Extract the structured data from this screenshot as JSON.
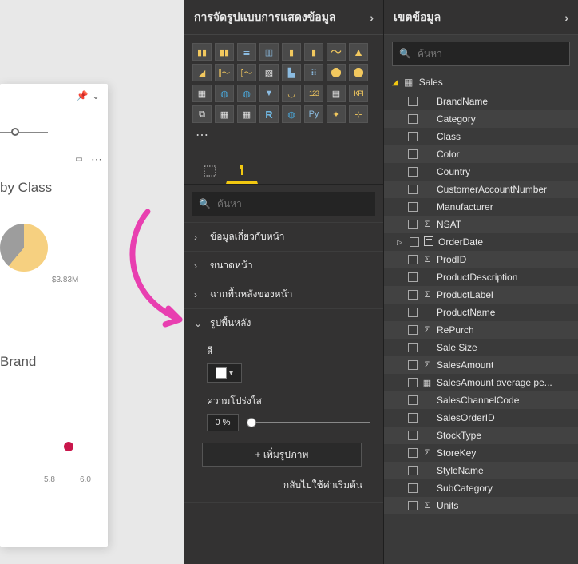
{
  "canvas": {
    "chart1_title": "by Class",
    "chart1_label": "$3.83M",
    "chart2_title": "Brand",
    "axis_tick1": "5.8",
    "axis_tick2": "6.0"
  },
  "viz": {
    "header": "การจัดรูปแบบการแสดงข้อมูล",
    "search_placeholder": "ค้นหา",
    "sections": {
      "page_info": "ข้อมูลเกี่ยวกับหน้า",
      "page_size": "ขนาดหน้า",
      "page_background": "ฉากพื้นหลังของหน้า",
      "wallpaper": "รูปพื้นหลัง"
    },
    "wallpaper_body": {
      "color_label": "สี",
      "transparency_label": "ความโปร่งใส",
      "transparency_value": "0",
      "transparency_unit": "%",
      "add_image_label": "+ เพิ่มรูปภาพ",
      "reset_label": "กลับไปใช้ค่าเริ่มต้น"
    }
  },
  "fields": {
    "header": "เขตข้อมูล",
    "search_placeholder": "ค้นหา",
    "table": "Sales",
    "items": [
      {
        "label": "BrandName",
        "sigil": "",
        "alt": false
      },
      {
        "label": "Category",
        "sigil": "",
        "alt": true
      },
      {
        "label": "Class",
        "sigil": "",
        "alt": false
      },
      {
        "label": "Color",
        "sigil": "",
        "alt": true
      },
      {
        "label": "Country",
        "sigil": "",
        "alt": false
      },
      {
        "label": "CustomerAccountNumber",
        "sigil": "",
        "alt": true
      },
      {
        "label": "Manufacturer",
        "sigil": "",
        "alt": false
      },
      {
        "label": "NSAT",
        "sigil": "Σ",
        "alt": true
      },
      {
        "label": "OrderDate",
        "sigil": "cal",
        "alt": false,
        "expandable": true
      },
      {
        "label": "ProdID",
        "sigil": "Σ",
        "alt": true
      },
      {
        "label": "ProductDescription",
        "sigil": "",
        "alt": false
      },
      {
        "label": "ProductLabel",
        "sigil": "Σ",
        "alt": true
      },
      {
        "label": "ProductName",
        "sigil": "",
        "alt": false
      },
      {
        "label": "RePurch",
        "sigil": "Σ",
        "alt": true
      },
      {
        "label": "Sale Size",
        "sigil": "",
        "alt": false
      },
      {
        "label": "SalesAmount",
        "sigil": "Σ",
        "alt": true
      },
      {
        "label": "SalesAmount average pe...",
        "sigil": "calc",
        "alt": false
      },
      {
        "label": "SalesChannelCode",
        "sigil": "",
        "alt": true
      },
      {
        "label": "SalesOrderID",
        "sigil": "",
        "alt": false
      },
      {
        "label": "StockType",
        "sigil": "",
        "alt": true
      },
      {
        "label": "StoreKey",
        "sigil": "Σ",
        "alt": false
      },
      {
        "label": "StyleName",
        "sigil": "",
        "alt": true
      },
      {
        "label": "SubCategory",
        "sigil": "",
        "alt": false
      },
      {
        "label": "Units",
        "sigil": "Σ",
        "alt": true
      }
    ]
  }
}
